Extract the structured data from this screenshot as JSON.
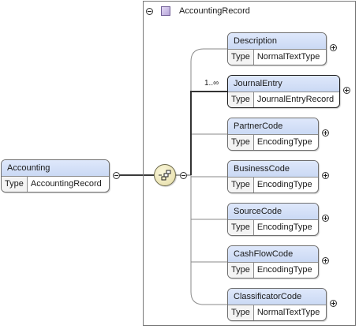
{
  "root": {
    "name": "Accounting",
    "type_label": "Type",
    "type": "AccountingRecord"
  },
  "complex_type": {
    "name": "AccountingRecord"
  },
  "compositor": {
    "icon": "sequence-compositor-icon"
  },
  "children": [
    {
      "name": "Description",
      "type_label": "Type",
      "type": "NormalTextType",
      "occurs": ""
    },
    {
      "name": "JournalEntry",
      "type_label": "Type",
      "type": "JournalEntryRecord",
      "occurs": "1..∞"
    },
    {
      "name": "PartnerCode",
      "type_label": "Type",
      "type": "EncodingType",
      "occurs": ""
    },
    {
      "name": "BusinessCode",
      "type_label": "Type",
      "type": "EncodingType",
      "occurs": ""
    },
    {
      "name": "SourceCode",
      "type_label": "Type",
      "type": "EncodingType",
      "occurs": ""
    },
    {
      "name": "CashFlowCode",
      "type_label": "Type",
      "type": "EncodingType",
      "occurs": ""
    },
    {
      "name": "ClassificatorCode",
      "type_label": "Type",
      "type": "NormalTextType",
      "occurs": ""
    }
  ]
}
